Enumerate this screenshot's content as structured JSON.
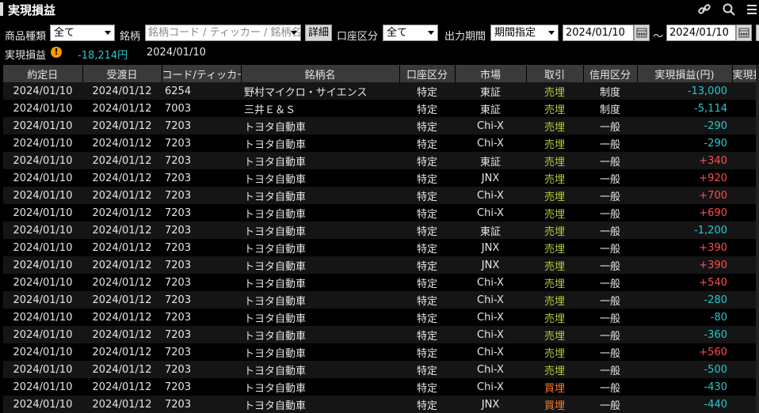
{
  "title": "実現損益",
  "filters": {
    "product_label": "商品種類",
    "product_value": "全て",
    "stock_label": "銘柄",
    "stock_placeholder": "銘柄コード / ティッカー / 銘柄名",
    "detail_button": "詳細",
    "account_label": "口座区分",
    "account_value": "全て",
    "period_label": "出力期間",
    "period_value": "期間指定",
    "date_from": "2024/01/10",
    "tilde": "～",
    "date_to": "2024/01/10"
  },
  "summary": {
    "label": "実現損益",
    "total": "-18,214円",
    "date": "2024/01/10"
  },
  "table": {
    "columns": [
      "約定日",
      "受渡日",
      "コード/ティッカー",
      "銘柄名",
      "口座区分",
      "市場",
      "取引",
      "信用区分",
      "実現損益(円)",
      "実現損"
    ],
    "rows": [
      {
        "trade_date": "2024/01/10",
        "settle_date": "2024/01/12",
        "code": "6254",
        "name": "野村マイクロ・サイエンス",
        "account": "特定",
        "market": "東証",
        "side": "売埋",
        "side_type": "sell",
        "credit": "制度",
        "pl": "-13,000",
        "pl_sign": "neg"
      },
      {
        "trade_date": "2024/01/10",
        "settle_date": "2024/01/12",
        "code": "7003",
        "name": "三井Ｅ＆Ｓ",
        "account": "特定",
        "market": "東証",
        "side": "売埋",
        "side_type": "sell",
        "credit": "制度",
        "pl": "-5,114",
        "pl_sign": "neg"
      },
      {
        "trade_date": "2024/01/10",
        "settle_date": "2024/01/12",
        "code": "7203",
        "name": "トヨタ自動車",
        "account": "特定",
        "market": "Chi-X",
        "side": "売埋",
        "side_type": "sell",
        "credit": "一般",
        "pl": "-290",
        "pl_sign": "neg"
      },
      {
        "trade_date": "2024/01/10",
        "settle_date": "2024/01/12",
        "code": "7203",
        "name": "トヨタ自動車",
        "account": "特定",
        "market": "Chi-X",
        "side": "売埋",
        "side_type": "sell",
        "credit": "一般",
        "pl": "-290",
        "pl_sign": "neg"
      },
      {
        "trade_date": "2024/01/10",
        "settle_date": "2024/01/12",
        "code": "7203",
        "name": "トヨタ自動車",
        "account": "特定",
        "market": "東証",
        "side": "売埋",
        "side_type": "sell",
        "credit": "一般",
        "pl": "+340",
        "pl_sign": "pos"
      },
      {
        "trade_date": "2024/01/10",
        "settle_date": "2024/01/12",
        "code": "7203",
        "name": "トヨタ自動車",
        "account": "特定",
        "market": "JNX",
        "side": "売埋",
        "side_type": "sell",
        "credit": "一般",
        "pl": "+920",
        "pl_sign": "pos"
      },
      {
        "trade_date": "2024/01/10",
        "settle_date": "2024/01/12",
        "code": "7203",
        "name": "トヨタ自動車",
        "account": "特定",
        "market": "Chi-X",
        "side": "売埋",
        "side_type": "sell",
        "credit": "一般",
        "pl": "+700",
        "pl_sign": "pos"
      },
      {
        "trade_date": "2024/01/10",
        "settle_date": "2024/01/12",
        "code": "7203",
        "name": "トヨタ自動車",
        "account": "特定",
        "market": "Chi-X",
        "side": "売埋",
        "side_type": "sell",
        "credit": "一般",
        "pl": "+690",
        "pl_sign": "pos"
      },
      {
        "trade_date": "2024/01/10",
        "settle_date": "2024/01/12",
        "code": "7203",
        "name": "トヨタ自動車",
        "account": "特定",
        "market": "東証",
        "side": "売埋",
        "side_type": "sell",
        "credit": "一般",
        "pl": "-1,200",
        "pl_sign": "neg"
      },
      {
        "trade_date": "2024/01/10",
        "settle_date": "2024/01/12",
        "code": "7203",
        "name": "トヨタ自動車",
        "account": "特定",
        "market": "JNX",
        "side": "売埋",
        "side_type": "sell",
        "credit": "一般",
        "pl": "+390",
        "pl_sign": "pos"
      },
      {
        "trade_date": "2024/01/10",
        "settle_date": "2024/01/12",
        "code": "7203",
        "name": "トヨタ自動車",
        "account": "特定",
        "market": "JNX",
        "side": "売埋",
        "side_type": "sell",
        "credit": "一般",
        "pl": "+390",
        "pl_sign": "pos"
      },
      {
        "trade_date": "2024/01/10",
        "settle_date": "2024/01/12",
        "code": "7203",
        "name": "トヨタ自動車",
        "account": "特定",
        "market": "Chi-X",
        "side": "売埋",
        "side_type": "sell",
        "credit": "一般",
        "pl": "+540",
        "pl_sign": "pos"
      },
      {
        "trade_date": "2024/01/10",
        "settle_date": "2024/01/12",
        "code": "7203",
        "name": "トヨタ自動車",
        "account": "特定",
        "market": "Chi-X",
        "side": "売埋",
        "side_type": "sell",
        "credit": "一般",
        "pl": "-280",
        "pl_sign": "neg"
      },
      {
        "trade_date": "2024/01/10",
        "settle_date": "2024/01/12",
        "code": "7203",
        "name": "トヨタ自動車",
        "account": "特定",
        "market": "Chi-X",
        "side": "売埋",
        "side_type": "sell",
        "credit": "一般",
        "pl": "-80",
        "pl_sign": "neg"
      },
      {
        "trade_date": "2024/01/10",
        "settle_date": "2024/01/12",
        "code": "7203",
        "name": "トヨタ自動車",
        "account": "特定",
        "market": "Chi-X",
        "side": "売埋",
        "side_type": "sell",
        "credit": "一般",
        "pl": "-360",
        "pl_sign": "neg"
      },
      {
        "trade_date": "2024/01/10",
        "settle_date": "2024/01/12",
        "code": "7203",
        "name": "トヨタ自動車",
        "account": "特定",
        "market": "Chi-X",
        "side": "売埋",
        "side_type": "sell",
        "credit": "一般",
        "pl": "+560",
        "pl_sign": "pos"
      },
      {
        "trade_date": "2024/01/10",
        "settle_date": "2024/01/12",
        "code": "7203",
        "name": "トヨタ自動車",
        "account": "特定",
        "market": "Chi-X",
        "side": "売埋",
        "side_type": "sell",
        "credit": "一般",
        "pl": "-500",
        "pl_sign": "neg"
      },
      {
        "trade_date": "2024/01/10",
        "settle_date": "2024/01/12",
        "code": "7203",
        "name": "トヨタ自動車",
        "account": "特定",
        "market": "Chi-X",
        "side": "買埋",
        "side_type": "buy",
        "credit": "一般",
        "pl": "-430",
        "pl_sign": "neg"
      },
      {
        "trade_date": "2024/01/10",
        "settle_date": "2024/01/12",
        "code": "7203",
        "name": "トヨタ自動車",
        "account": "特定",
        "market": "JNX",
        "side": "買埋",
        "side_type": "buy",
        "credit": "一般",
        "pl": "-440",
        "pl_sign": "neg"
      }
    ]
  },
  "icons": [
    "link-icon",
    "search-icon",
    "menu-icon",
    "warning-icon",
    "calendar-icon"
  ],
  "colors": {
    "sell": "#b7c93a",
    "buy": "#ff7a2a",
    "positive": "#ff4d4d",
    "negative": "#28c8c8",
    "warning": "#ff9800"
  }
}
